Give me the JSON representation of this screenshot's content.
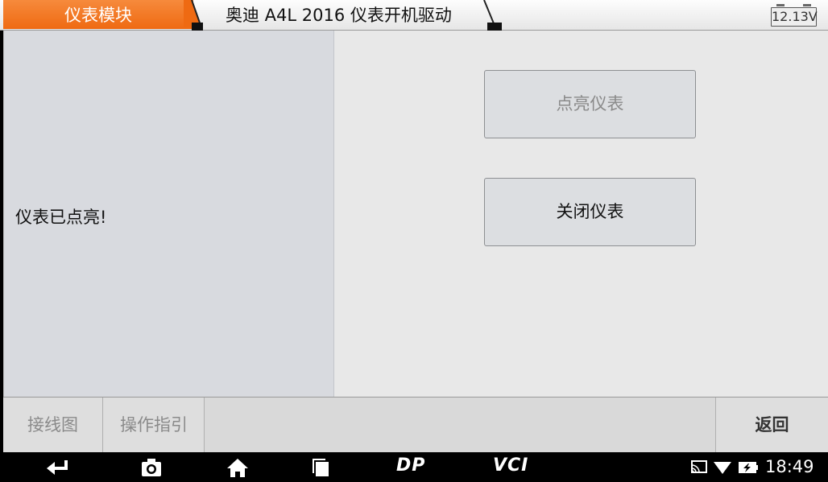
{
  "breadcrumb": {
    "active_label": "仪表模块",
    "second_label": "奥迪 A4L 2016 仪表开机驱动"
  },
  "battery": {
    "voltage": "12.13V"
  },
  "status": {
    "message": "仪表已点亮!"
  },
  "actions": {
    "light_on_label": "点亮仪表",
    "light_off_label": "关闭仪表"
  },
  "function_bar": {
    "wiring_label": "接线图",
    "guide_label": "操作指引",
    "back_label": "返回"
  },
  "navbar": {
    "icons": [
      "back-icon",
      "camera-icon",
      "home-icon",
      "recent-apps-icon"
    ],
    "dp_label": "DP",
    "vci_label": "VCI",
    "time": "18:49"
  },
  "colors": {
    "accent": "#ef6a12",
    "panel_left": "#d8dadf",
    "panel_main": "#e8e8e8"
  }
}
